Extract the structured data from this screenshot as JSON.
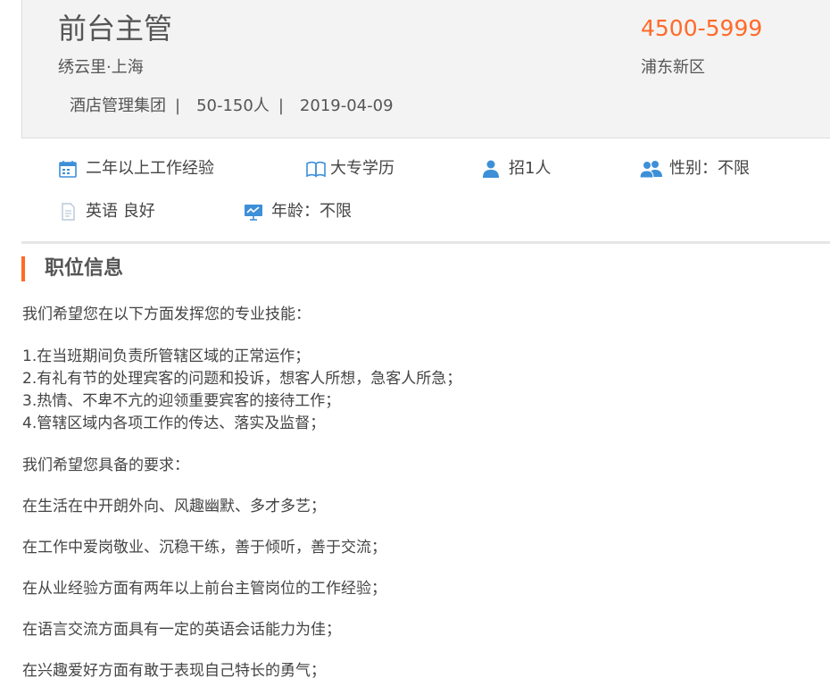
{
  "job": {
    "title": "前台主管",
    "salary": "4500-5999",
    "company_location": "绣云里·上海",
    "district": "浦东新区",
    "industry": "酒店管理集团",
    "size": "50-150人",
    "date": "2019-04-09",
    "separator": "|"
  },
  "requirements": {
    "experience": "二年以上工作经验",
    "education": "大专学历",
    "headcount": "招1人",
    "gender": "性别：不限",
    "language": "英语 良好",
    "age": "年龄：不限"
  },
  "section": {
    "title": "职位信息"
  },
  "description": {
    "intro": "我们希望您在以下方面发挥您的专业技能：",
    "duties": [
      "1.在当班期间负责所管辖区域的正常运作；",
      "2.有礼有节的处理宾客的问题和投诉，想客人所想，急客人所急；",
      "3.热情、不卑不亢的迎领重要宾客的接待工作；",
      "4.管辖区域内各项工作的传达、落实及监督；"
    ],
    "req_intro": "我们希望您具备的要求：",
    "reqs": [
      "在生活在中开朗外向、风趣幽默、多才多艺；",
      "在工作中爱岗敬业、沉稳干练，善于倾听，善于交流；",
      "在从业经验方面有两年以上前台主管岗位的工作经验；",
      "在语言交流方面具有一定的英语会话能力为佳；",
      "在兴趣爱好方面有敢于表现自己特长的勇气；"
    ]
  },
  "colors": {
    "accent": "#ff6a28",
    "icon_blue": "#3d8fd8",
    "header_bg": "#f3f3f3"
  },
  "icons": [
    "calendar-icon",
    "book-icon",
    "person-icon",
    "people-icon",
    "document-icon",
    "chart-board-icon"
  ]
}
